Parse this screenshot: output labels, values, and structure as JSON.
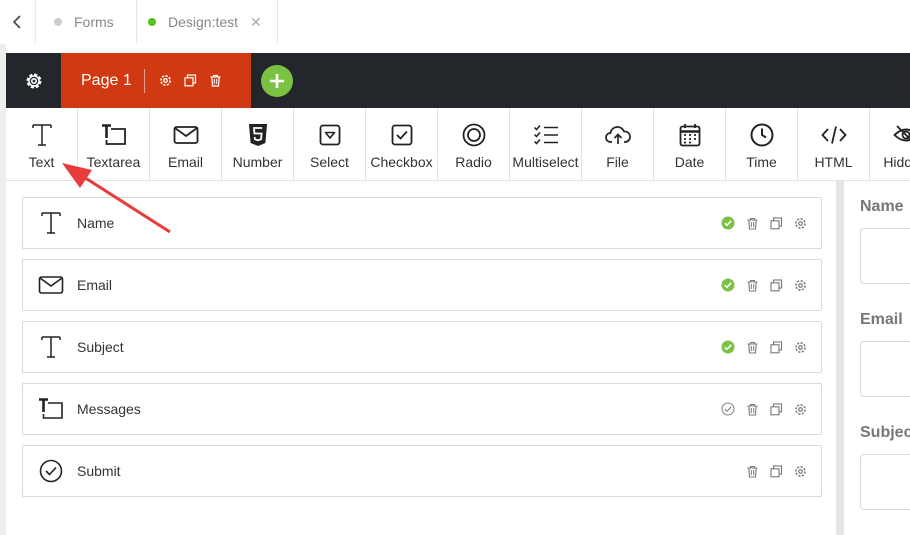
{
  "tabs": [
    {
      "label": "Forms",
      "dot_color": "#cccccc"
    },
    {
      "label": "Design:test",
      "dot_color": "#52c41a"
    }
  ],
  "page_bar": {
    "page_label": "Page 1",
    "accent_color": "#cf3a12",
    "add_color": "#7bc144"
  },
  "toolbox": [
    {
      "label": "Text",
      "icon": "text-t-icon"
    },
    {
      "label": "Textarea",
      "icon": "textarea-icon"
    },
    {
      "label": "Email",
      "icon": "envelope-icon"
    },
    {
      "label": "Number",
      "icon": "html5-number-icon"
    },
    {
      "label": "Select",
      "icon": "select-dropdown-icon"
    },
    {
      "label": "Checkbox",
      "icon": "checkbox-icon"
    },
    {
      "label": "Radio",
      "icon": "radio-icon"
    },
    {
      "label": "Multiselect",
      "icon": "multiselect-list-icon"
    },
    {
      "label": "File",
      "icon": "cloud-upload-icon"
    },
    {
      "label": "Date",
      "icon": "calendar-icon"
    },
    {
      "label": "Time",
      "icon": "clock-icon"
    },
    {
      "label": "HTML",
      "icon": "code-icon"
    },
    {
      "label": "Hidden",
      "icon": "eye-slash-icon"
    }
  ],
  "fields": [
    {
      "label": "Name",
      "icon": "text-t-icon",
      "required": true
    },
    {
      "label": "Email",
      "icon": "envelope-icon",
      "required": true
    },
    {
      "label": "Subject",
      "icon": "text-t-icon",
      "required": true
    },
    {
      "label": "Messages",
      "icon": "textarea-icon",
      "required": false
    },
    {
      "label": "Submit",
      "icon": "check-circle-icon",
      "required": null
    }
  ],
  "preview": {
    "labels": [
      "Name",
      "Email",
      "Subject"
    ]
  },
  "colors": {
    "check_green": "#7bc144",
    "dark_bar": "#23272b",
    "annotation_arrow": "#e83c3c"
  }
}
